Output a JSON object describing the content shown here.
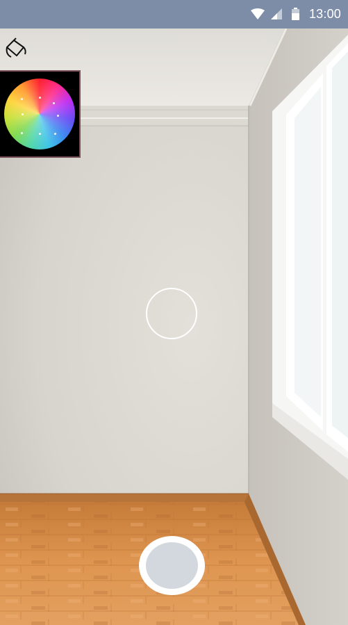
{
  "status_bar": {
    "time": "13:00",
    "icons": [
      "wifi-icon",
      "cell-signal-icon",
      "battery-icon"
    ],
    "background": "#7d8da8"
  },
  "controls": {
    "paint_bucket_icon": "paint-bucket-icon",
    "color_wheel": "color-wheel-palette",
    "capture_button_color": "#d2d8de"
  },
  "colors": {
    "wall": "#d8d5cf",
    "floor": "#d89048",
    "window_frame": "#f7f7f5",
    "palette_border": "#7a5158"
  }
}
